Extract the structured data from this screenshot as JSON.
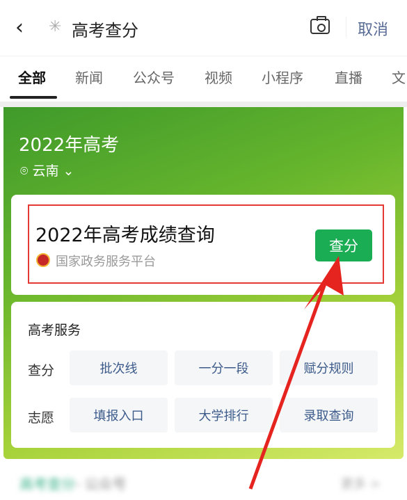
{
  "header": {
    "back_icon": "chevron-left",
    "search_query": "高考查分",
    "camera_icon": "camera",
    "cancel": "取消"
  },
  "tabs": [
    {
      "label": "全部",
      "active": true
    },
    {
      "label": "新闻"
    },
    {
      "label": "公众号"
    },
    {
      "label": "视频"
    },
    {
      "label": "小程序"
    },
    {
      "label": "直播"
    },
    {
      "label": "文"
    }
  ],
  "hero": {
    "title": "2022年高考",
    "location": "云南",
    "accent": "#1aad53"
  },
  "result_card": {
    "title": "2022年高考成绩查询",
    "source": "国家政务服务平台",
    "button": "查分",
    "highlight_color": "#e53935"
  },
  "services": {
    "title": "高考服务",
    "rows": [
      {
        "label": "查分",
        "items": [
          "批次线",
          "一分一段",
          "赋分规则"
        ]
      },
      {
        "label": "志愿",
        "items": [
          "填报入口",
          "大学排行",
          "录取查询"
        ]
      }
    ]
  },
  "below": {
    "title_a": "高考查分",
    "title_b": "- 公众号",
    "more": "更多 >"
  }
}
